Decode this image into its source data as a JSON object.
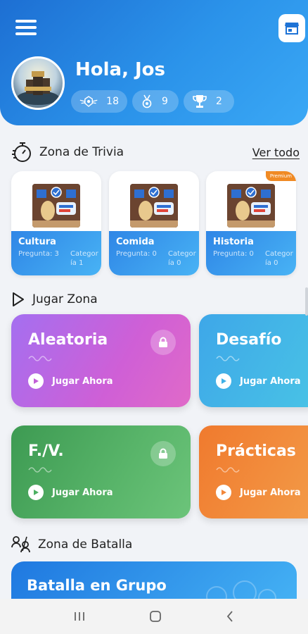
{
  "header": {
    "greeting": "Hola, Jos",
    "stats": [
      {
        "icon": "badge-icon",
        "value": "18"
      },
      {
        "icon": "medal-icon",
        "value": "9"
      },
      {
        "icon": "trophy-icon",
        "value": "2"
      }
    ]
  },
  "trivia": {
    "title": "Zona de Trivia",
    "see_all": "Ver todo",
    "cards": [
      {
        "name": "Cultura",
        "question": "Pregunta: 3",
        "category_1": "Categor",
        "category_2": "ía 1",
        "premium": ""
      },
      {
        "name": "Comida",
        "question": "Pregunta: 0",
        "category_1": "Categor",
        "category_2": "ía 0",
        "premium": ""
      },
      {
        "name": "Historia",
        "question": "Pregunta: 0",
        "category_1": "Categor",
        "category_2": "ía 0",
        "premium": "Premium"
      }
    ]
  },
  "play": {
    "title": "Jugar Zona",
    "action_label": "Jugar Ahora",
    "cards": [
      {
        "title": "Aleatoria",
        "locked": true,
        "color": "#b86ae8"
      },
      {
        "title": "Desafío",
        "locked": false,
        "color": "#3fb6e8"
      },
      {
        "title": "F./V.",
        "locked": true,
        "color": "#4caf62"
      },
      {
        "title": "Prácticas",
        "locked": false,
        "color": "#f28a3b"
      }
    ]
  },
  "battle": {
    "title": "Zona de Batalla",
    "card_title": "Batalla en Grupo"
  },
  "colors": {
    "header_blue": "#2b8be6",
    "trivia_blue": "#3a9cee"
  }
}
